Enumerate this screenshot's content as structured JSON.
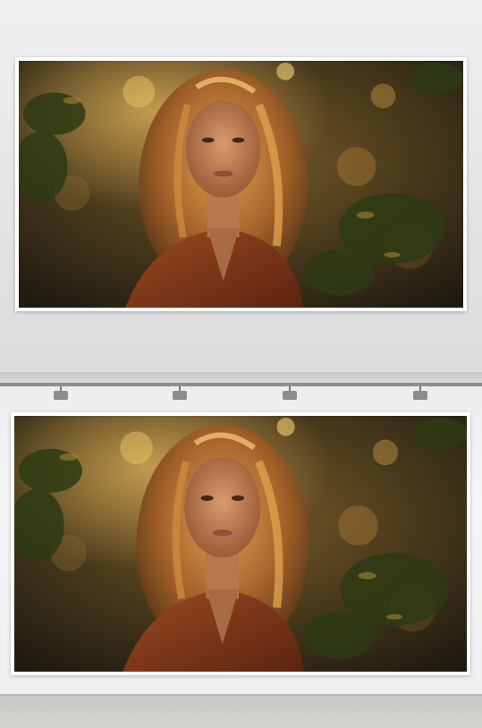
{
  "scene": {
    "description_icons": [
      "portrait-photo",
      "spotlight-icon"
    ],
    "colors": {
      "wall": "#e6e6e8",
      "frame": "#ffffff",
      "photo_dark": "#2a2414",
      "photo_glow": "#e0a040",
      "hair": "#b07030",
      "dress": "#8a3a18",
      "floor": "#cfcdca"
    }
  }
}
